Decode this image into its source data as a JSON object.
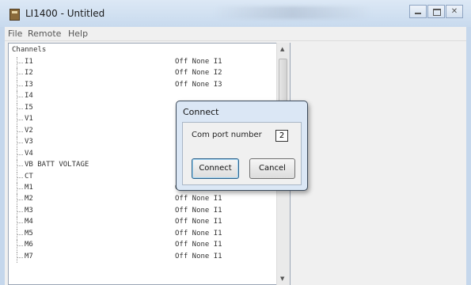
{
  "window": {
    "title": "LI1400 - Untitled"
  },
  "menu": [
    "File",
    "Remote",
    "Help"
  ],
  "tree": {
    "root": "Channels",
    "rows": [
      {
        "name": "I1",
        "value": "Off None I1"
      },
      {
        "name": "I2",
        "value": "Off None I2"
      },
      {
        "name": "I3",
        "value": "Off None I3"
      },
      {
        "name": "I4",
        "value": ""
      },
      {
        "name": "I5",
        "value": ""
      },
      {
        "name": "V1",
        "value": ""
      },
      {
        "name": "V2",
        "value": ""
      },
      {
        "name": "V3",
        "value": ""
      },
      {
        "name": "V4",
        "value": ""
      },
      {
        "name": "VB BATT VOLTAGE",
        "value": ""
      },
      {
        "name": "CT",
        "value": ""
      },
      {
        "name": "M1",
        "value": "Off None I1"
      },
      {
        "name": "M2",
        "value": "Off None I1"
      },
      {
        "name": "M3",
        "value": "Off None I1"
      },
      {
        "name": "M4",
        "value": "Off None I1"
      },
      {
        "name": "M5",
        "value": "Off None I1"
      },
      {
        "name": "M6",
        "value": "Off None I1"
      },
      {
        "name": "M7",
        "value": "Off None I1"
      }
    ]
  },
  "dialog": {
    "title": "Connect",
    "com_label": "Com port number",
    "com_value": "2",
    "connect_label": "Connect",
    "cancel_label": "Cancel"
  }
}
